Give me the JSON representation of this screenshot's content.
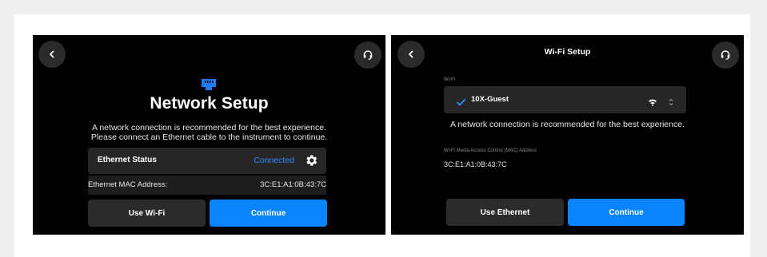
{
  "network_setup": {
    "title": "Network Setup",
    "description_line1": "A network connection is recommended for the best experience.",
    "description_line2": "Please connect an Ethernet cable to the instrument to continue.",
    "ethernet_status_label": "Ethernet Status",
    "ethernet_status_value": "Connected",
    "mac_label": "Ethernet MAC Address:",
    "mac_value": "3C:E1:A1:0B:43:7C",
    "use_wifi_label": "Use Wi-Fi",
    "continue_label": "Continue",
    "icons": [
      "back-icon",
      "support-headset-icon",
      "ethernet-icon",
      "gear-icon"
    ]
  },
  "wifi_setup": {
    "title": "Wi-Fi Setup",
    "wifi_label": "Wi-Fi",
    "network_name": "10X-Guest",
    "description": "A network connection is recommended for the best experience.",
    "mac_label": "Wi-Fi Media Access Control (MAC) Address",
    "mac_value": "3C:E1:A1:0B:43:7C",
    "use_ethernet_label": "Use Ethernet",
    "continue_label": "Continue",
    "icons": [
      "back-icon",
      "support-headset-icon",
      "checkmark-icon",
      "wifi-signal-icon",
      "updown-chevron-icon"
    ]
  },
  "colors": {
    "accent": "#0a84ff",
    "status_connected": "#2f8cff",
    "screen_bg": "#000000",
    "panel_bg": "#262626"
  }
}
